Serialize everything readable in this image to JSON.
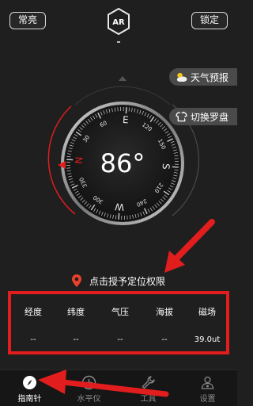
{
  "header": {
    "left_button": "常亮",
    "center_icon": "ar-icon",
    "right_button": "锁定"
  },
  "side_buttons": [
    {
      "label": "天气预报",
      "icon": "weather-icon"
    },
    {
      "label": "切换罗盘",
      "icon": "shirt-icon"
    }
  ],
  "compass": {
    "heading": "86°",
    "cardinals": {
      "N": "N",
      "E": "E",
      "S": "S",
      "W": "W"
    },
    "ticks": [
      "30",
      "60",
      "120",
      "150",
      "210",
      "240",
      "300",
      "330"
    ],
    "accent_color": "#e11d1d"
  },
  "location_prompt": "点击授予定位权限",
  "stats": [
    {
      "label": "经度",
      "value": "--"
    },
    {
      "label": "纬度",
      "value": "--"
    },
    {
      "label": "气压",
      "value": "--"
    },
    {
      "label": "海拔",
      "value": "--"
    },
    {
      "label": "磁场",
      "value": "39.0ut"
    }
  ],
  "nav": [
    {
      "label": "指南针",
      "icon": "compass-icon",
      "active": true
    },
    {
      "label": "水平仪",
      "icon": "level-icon",
      "active": false
    },
    {
      "label": "工具",
      "icon": "wrench-icon",
      "active": false
    },
    {
      "label": "设置",
      "icon": "settings-icon",
      "active": false
    }
  ]
}
